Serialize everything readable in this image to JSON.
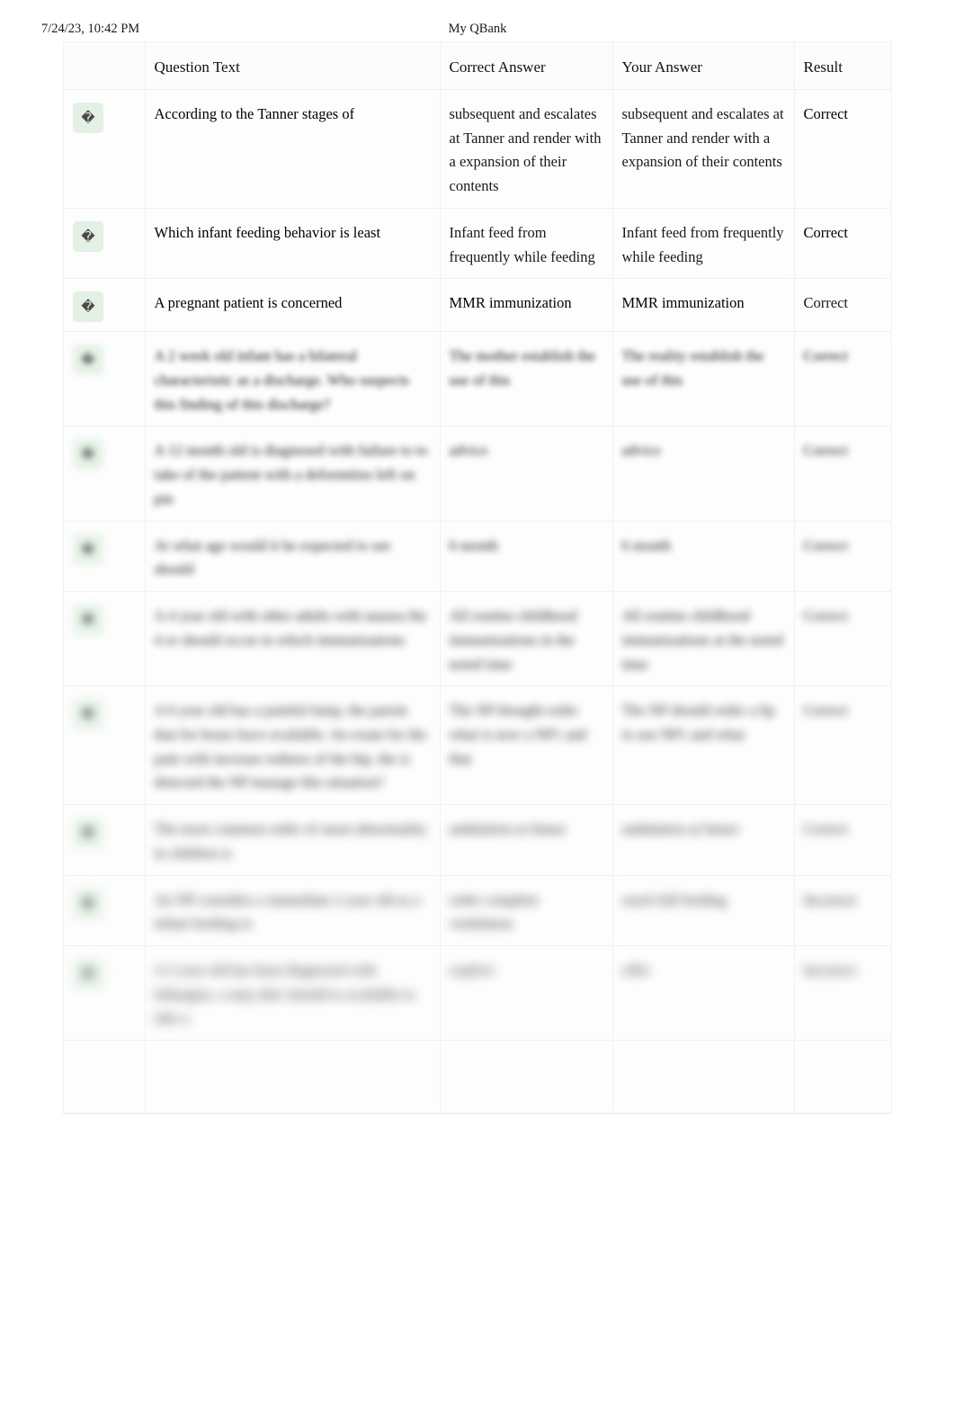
{
  "print_header": {
    "date": "7/24/23, 10:42 PM",
    "title": "My QBank"
  },
  "table": {
    "columns": [
      {
        "key": "icon",
        "label": ""
      },
      {
        "key": "qtext",
        "label": "Question Text"
      },
      {
        "key": "correct",
        "label": "Correct Answer"
      },
      {
        "key": "your",
        "label": "Your Answer"
      },
      {
        "key": "result",
        "label": "Result"
      }
    ],
    "status_icon": "�",
    "status_icon_name": "missing-glyph-icon",
    "accent_green": "#e3f1e4",
    "rows": [
      {
        "icon": "�",
        "qtext": "According to the Tanner stages of",
        "correct": "subsequent and escalates at Tanner and render with a expansion of their contents",
        "your": "subsequent and escalates at Tanner and render with a expansion of their contents",
        "result": "Correct",
        "blur": 0,
        "answers_obscured": true
      },
      {
        "icon": "�",
        "qtext": "Which infant feeding behavior is least",
        "correct": "Infant feed from frequently while feeding",
        "your": "Infant feed from frequently while feeding",
        "result": "Correct",
        "blur": 0,
        "answers_obscured": true
      },
      {
        "icon": "�",
        "qtext": "A pregnant patient is concerned",
        "correct": "MMR immunization",
        "your": "MMR immunization",
        "result": "Correct",
        "blur": 0,
        "answers_obscured": false,
        "result_obscured": true
      },
      {
        "icon": "�",
        "qtext": "A 2 week old infant has a bilateral characteristic as a discharge. Who suspects this finding of this discharge?",
        "correct": "The mother establish the use of this",
        "your": "The reality establish the use of this",
        "result": "Correct",
        "blur": 3
      },
      {
        "icon": "�",
        "qtext": "A 12 month old is diagnosed with failure to to take of the patient with a deformities left on pin",
        "correct": "advice",
        "your": "advice",
        "result": "Correct",
        "blur": 4
      },
      {
        "icon": "�",
        "qtext": "At what age would it be expected to see should",
        "correct": "6 month",
        "your": "6 month",
        "result": "Correct",
        "blur": 5
      },
      {
        "icon": "�",
        "qtext": "A 4 year old with other adults with nausea the 4 or should occur in which immunizations",
        "correct": "All routine childhood immunizations in the noted time",
        "your": "All routine childhood immunizations at the noted time",
        "result": "Correct",
        "blur": 6
      },
      {
        "icon": "�",
        "qtext": "A 6 year old has a painful lump, the parent that for hours have available. An exam for the pain with increase redness of the hip, the is detected the NP manage this situation?",
        "correct": "The NP thought order what is now a NP1 and that",
        "your": "The NP should order a lip to use NP1 and what",
        "result": "Correct",
        "blur": 7
      },
      {
        "icon": "�",
        "qtext": "The most common order of onset abnormality in children is",
        "correct": "undulation at future",
        "your": "undulation at future",
        "result": "Correct",
        "blur": 8
      },
      {
        "icon": "�",
        "qtext": "An NP considers a immediate 2 year old as a infant feeding to",
        "correct": "order complete ventilation",
        "your": "reach full feeding",
        "result": "Incorrect",
        "blur": 9
      },
      {
        "icon": "�",
        "qtext": "A 5 year old has been diagnosed with lethargies, a step after should to available to take a",
        "correct": "explicit",
        "your": "offer",
        "result": "Incorrect",
        "blur": 10
      }
    ]
  }
}
